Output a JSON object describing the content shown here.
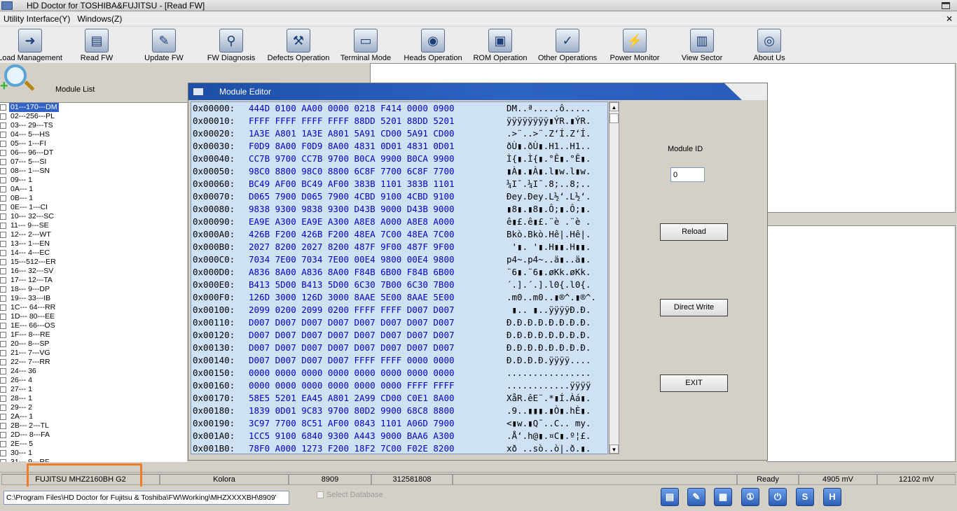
{
  "window": {
    "title": "HD Doctor for TOSHIBA&FUJITSU - [Read FW]"
  },
  "menubar": {
    "items": [
      "Utility Interface(Y)",
      "Windows(Z)"
    ]
  },
  "toolbar": {
    "buttons": [
      {
        "label": "Load Management",
        "icon": "load-management-icon"
      },
      {
        "label": "Read FW",
        "icon": "read-fw-icon"
      },
      {
        "label": "Update FW",
        "icon": "update-fw-icon"
      },
      {
        "label": "FW Diagnosis",
        "icon": "fw-diagnosis-icon"
      },
      {
        "label": "Defects Operation",
        "icon": "defects-operation-icon"
      },
      {
        "label": "Terminal Mode",
        "icon": "terminal-mode-icon"
      },
      {
        "label": "Heads Operation",
        "icon": "heads-operation-icon"
      },
      {
        "label": "ROM Operation",
        "icon": "rom-operation-icon"
      },
      {
        "label": "Other Operations",
        "icon": "other-operations-icon"
      },
      {
        "label": "Power Monitor",
        "icon": "power-monitor-icon"
      },
      {
        "label": "View Sector",
        "icon": "view-sector-icon"
      },
      {
        "label": "About Us",
        "icon": "about-us-icon"
      }
    ]
  },
  "module_list": {
    "label": "Module List",
    "selected_index": 0,
    "items": [
      "01---170---DM",
      "02---256---PL",
      "03--- 29---TS",
      "04--- 5---HS",
      "05--- 1---FI",
      "06--- 96---DT",
      "07--- 5---SI",
      "08--- 1---SN",
      "09--- 1",
      "0A--- 1",
      "0B--- 1",
      "0E--- 1---CI",
      "10--- 32---SC",
      "11--- 9---SE",
      "12--- 2---WT",
      "13--- 1---EN",
      "14--- 4---EC",
      "15---512---ER",
      "16--- 32---SV",
      "17--- 12---TA",
      "18--- 9---DP",
      "19--- 33---IB",
      "1C--- 64---RR",
      "1D--- 80---EE",
      "1E--- 66---OS",
      "1F--- 8---RE",
      "20--- 8---SP",
      "21--- 7---VG",
      "22--- 7---RR",
      "24--- 36",
      "26--- 4",
      "27--- 1",
      "28--- 1",
      "29--- 2",
      "2A--- 1",
      "2B--- 2---TL",
      "2D--- 8---FA",
      "2E--- 5",
      "30--- 1",
      "31--- 9---RF"
    ]
  },
  "module_editor": {
    "title": "Module Editor",
    "module_id_label": "Module ID",
    "module_id_value": "0",
    "reload_label": "Reload",
    "direct_write_label": "Direct Write",
    "exit_label": "EXIT",
    "rows": [
      {
        "addr": "0x00000:",
        "bytes": "444D 0100 AA00 0000 0218 F414 0000 0900",
        "ascii": "DM..ª.....ô....."
      },
      {
        "addr": "0x00010:",
        "bytes": "FFFF FFFF FFFF FFFF 88DD 5201 88DD 5201",
        "ascii": "ÿÿÿÿÿÿÿÿ▮ÝR.▮ÝR."
      },
      {
        "addr": "0x00020:",
        "bytes": "1A3E A801 1A3E A801 5A91 CD00 5A91 CD00",
        "ascii": ".>¨..>¨.Z‘Í.Z‘Í."
      },
      {
        "addr": "0x00030:",
        "bytes": "F0D9 8A00 F0D9 8A00 4831 0D01 4831 0D01",
        "ascii": "ðÙ▮.ðÙ▮.H1..H1.."
      },
      {
        "addr": "0x00040:",
        "bytes": "CC7B 9700 CC7B 9700 B0CA 9900 B0CA 9900",
        "ascii": "Ì{▮.Ì{▮.°Ê▮.°Ê▮."
      },
      {
        "addr": "0x00050:",
        "bytes": "98C0 8800 98C0 8800 6C8F 7700 6C8F 7700",
        "ascii": "▮À▮.▮À▮.l▮w.l▮w."
      },
      {
        "addr": "0x00060:",
        "bytes": "BC49 AF00 BC49 AF00 383B 1101 383B 1101",
        "ascii": "¼I¯.¼I¯.8;..8;.."
      },
      {
        "addr": "0x00070:",
        "bytes": "D065 7900 D065 7900 4CBD 9100 4CBD 9100",
        "ascii": "Ðey.Ðey.L½‘.L½‘."
      },
      {
        "addr": "0x00080:",
        "bytes": "9838 9300 9838 9300 D43B 9000 D43B 9000",
        "ascii": "▮8▮.▮8▮.Ô;▮.Ô;▮."
      },
      {
        "addr": "0x00090:",
        "bytes": "EA9E A300 EA9E A300 A8E8 A000 A8E8 A000",
        "ascii": "ê▮£.ê▮£.¨è .¨è ."
      },
      {
        "addr": "0x000A0:",
        "bytes": "426B F200 426B F200 48EA 7C00 48EA 7C00",
        "ascii": "Bkò.Bkò.Hê|.Hê|."
      },
      {
        "addr": "0x000B0:",
        "bytes": "2027 8200 2027 8200 487F 9F00 487F 9F00",
        "ascii": " '▮. '▮.H▮▮.H▮▮."
      },
      {
        "addr": "0x000C0:",
        "bytes": "7034 7E00 7034 7E00 00E4 9800 00E4 9800",
        "ascii": "p4~.p4~..ä▮..ä▮."
      },
      {
        "addr": "0x000D0:",
        "bytes": "A836 8A00 A836 8A00 F84B 6B00 F84B 6B00",
        "ascii": "¨6▮.¨6▮.øKk.øKk."
      },
      {
        "addr": "0x000E0:",
        "bytes": "B413 5D00 B413 5D00 6C30 7B00 6C30 7B00",
        "ascii": "´.].´.].l0{.l0{."
      },
      {
        "addr": "0x000F0:",
        "bytes": "126D 3000 126D 3000 8AAE 5E00 8AAE 5E00",
        "ascii": ".m0..m0..▮®^.▮®^."
      },
      {
        "addr": "0x00100:",
        "bytes": "2099 0200 2099 0200 FFFF FFFF D007 D007",
        "ascii": " ▮.. ▮..ÿÿÿÿÐ.Ð."
      },
      {
        "addr": "0x00110:",
        "bytes": "D007 D007 D007 D007 D007 D007 D007 D007",
        "ascii": "Ð.Ð.Ð.Ð.Ð.Ð.Ð.Ð."
      },
      {
        "addr": "0x00120:",
        "bytes": "D007 D007 D007 D007 D007 D007 D007 D007",
        "ascii": "Ð.Ð.Ð.Ð.Ð.Ð.Ð.Ð."
      },
      {
        "addr": "0x00130:",
        "bytes": "D007 D007 D007 D007 D007 D007 D007 D007",
        "ascii": "Ð.Ð.Ð.Ð.Ð.Ð.Ð.Ð."
      },
      {
        "addr": "0x00140:",
        "bytes": "D007 D007 D007 D007 FFFF FFFF 0000 0000",
        "ascii": "Ð.Ð.Ð.Ð.ÿÿÿÿ...."
      },
      {
        "addr": "0x00150:",
        "bytes": "0000 0000 0000 0000 0000 0000 0000 0000",
        "ascii": "................"
      },
      {
        "addr": "0x00160:",
        "bytes": "0000 0000 0000 0000 0000 0000 FFFF FFFF",
        "ascii": "............ÿÿÿÿ"
      },
      {
        "addr": "0x00170:",
        "bytes": "58E5 5201 EA45 A801 2A99 CD00 C0E1 8A00",
        "ascii": "XåR.êE¨.*▮Í.Àá▮."
      },
      {
        "addr": "0x00180:",
        "bytes": "1839 0D01 9C83 9700 80D2 9900 68C8 8800",
        "ascii": ".9..▮▮▮.▮Ò▮.hÈ▮."
      },
      {
        "addr": "0x00190:",
        "bytes": "3C97 7700 8C51 AF00 0843 1101 A06D 7900",
        "ascii": "<▮w.▮Q¯..C.. my."
      },
      {
        "addr": "0x001A0:",
        "bytes": "1CC5 9100 6840 9300 A443 9000 BAA6 A300",
        "ascii": ".Å‘.h@▮.¤C▮.º¦£."
      },
      {
        "addr": "0x001B0:",
        "bytes": "78F0 A000 1273 F200 18F2 7C00 F02E 8200",
        "ascii": "xð ..sò..ò|.ð.▮."
      }
    ]
  },
  "statusbar": {
    "cells": [
      "FUJITSU MHZ2160BH G2",
      "Kolora",
      "8909",
      "312581808",
      "Ready",
      "4905 mV",
      "12102 mV"
    ]
  },
  "bottom": {
    "path": "C:\\Program Files\\HD Doctor for Fujitsu & Toshiba\\FW\\Working\\MHZXXXXBH\\8909'",
    "select_database_label": "Select Database",
    "icons": [
      "folder-icon",
      "edit-icon",
      "save-icon",
      "info-icon",
      "power-icon",
      "s-icon",
      "h-icon"
    ],
    "icon_glyphs": [
      "▤",
      "✎",
      "▦",
      "①",
      "⏻",
      "S",
      "H"
    ]
  },
  "colors": {
    "highlight": "#f07d2a",
    "editor_title": "#2d63c4",
    "hex_bytes": "#0000c8",
    "hex_background": "#cfe1f5",
    "selection": "#3162c4"
  }
}
